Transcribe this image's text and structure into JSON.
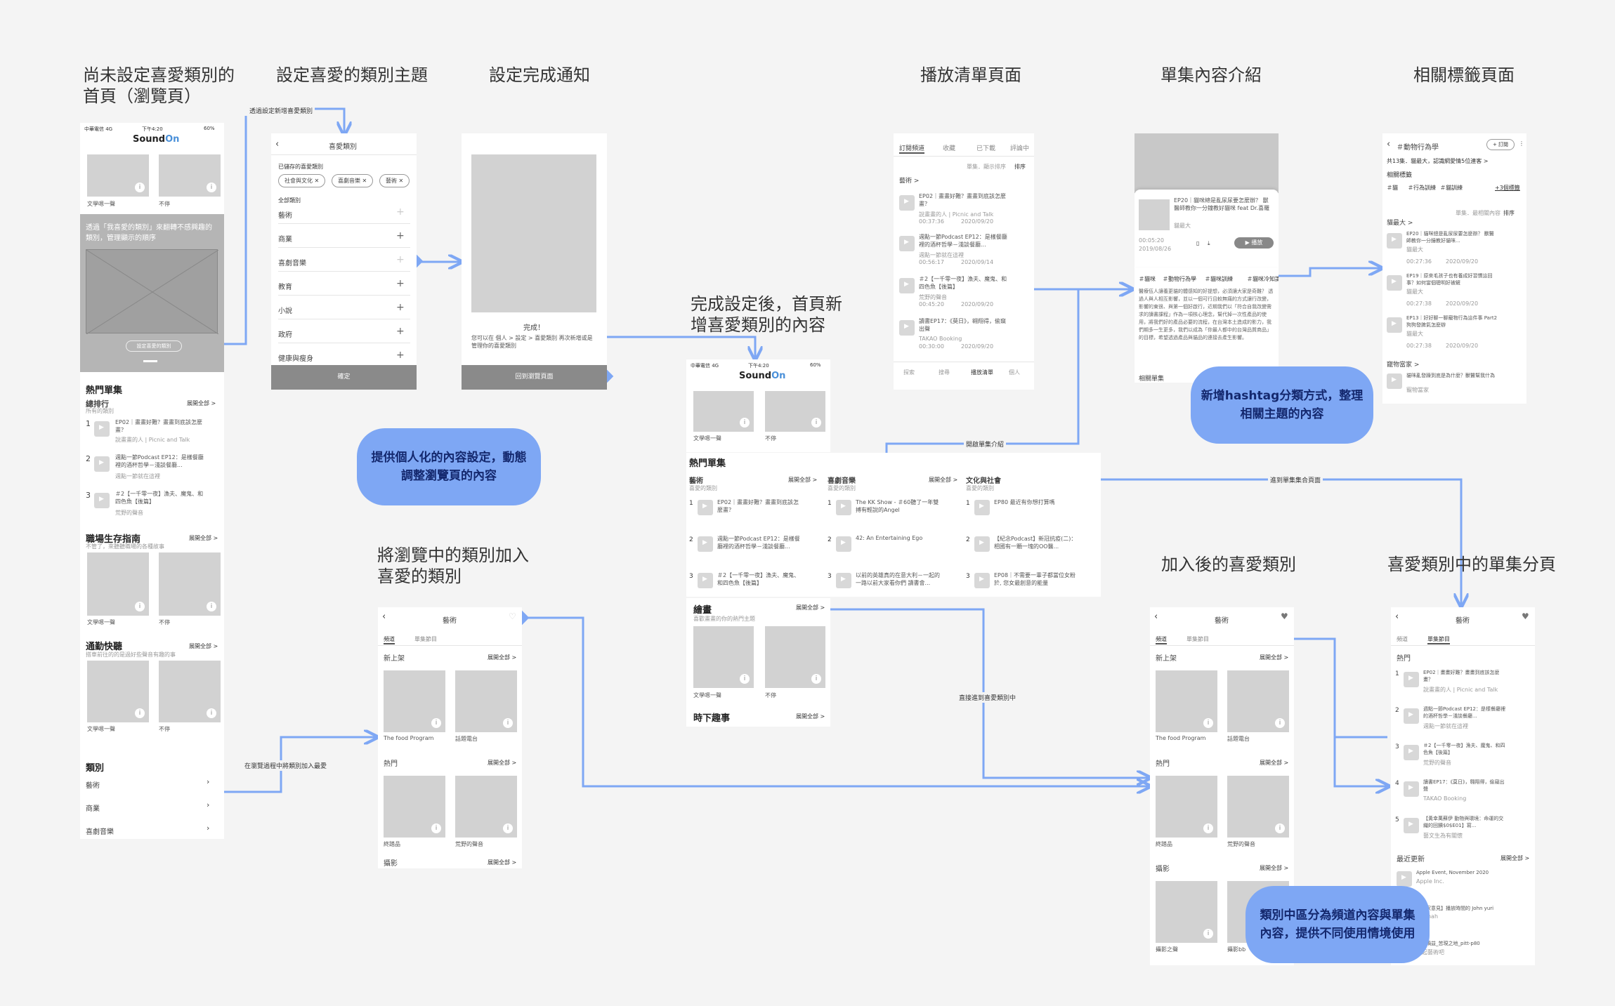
{
  "section_titles": {
    "home_unset": "尚未設定喜愛類別的\n首頁（瀏覽頁）",
    "set_fav": "設定喜愛的類別主題",
    "done_notice": "設定完成通知",
    "home_after": "完成設定後，首頁新\n增喜愛類別的內容",
    "playlist": "播放清單頁面",
    "episode_intro": "單集內容介紹",
    "tag_page": "相關標籤頁面",
    "add_browse": "將瀏覽中的類別加入\n喜愛的類別",
    "after_add": "加入後的喜愛類別",
    "fav_episode": "喜愛類別中的單集分頁"
  },
  "bubbles": {
    "personalize": "提供個人化的內容設定，動態\n調整瀏覽頁的內容",
    "hashtag": "新增hashtag分類方式，整理\n相關主題的內容",
    "channel_split": "類別中區分為頻道內容與單集\n內容，提供不同使用情境使用"
  },
  "flow_labels": {
    "via_new": "透過設定新增喜愛類別",
    "open_intro": "開啟單集介紹",
    "to_episode_page": "進到單集集合頁面",
    "add_direct": "直接進到喜愛類別中",
    "add_while_browse": "在瀏覽過程中將類別加入最愛"
  },
  "home": {
    "status_left": "中華電信 4G",
    "status_time": "下午4:20",
    "status_right": "60%",
    "logo_a": "Sound",
    "logo_b": "On",
    "thumb1": "文學嗯一聲",
    "thumb2": "不停",
    "banner_text": "透過「我喜愛的類別」來翻轉不感興趣的類別，管理顯示的順序",
    "banner_btn": "設定喜愛的類別",
    "hot_title": "熱門單集",
    "rank_title": "總排行",
    "rank_sub": "所有的類別",
    "see_all": "展開全部 >",
    "items": [
      {
        "no": "1",
        "title": "EP02｜畫畫好難？畫畫到底該怎麼畫？",
        "sub": "說畫畫的人 | Picnic and Talk"
      },
      {
        "no": "2",
        "title": "週點一節Podcast EP12：是樣餐廳裡的酒杯哲學－淺談餐廳...",
        "sub": "週點一節就在這裡"
      },
      {
        "no": "3",
        "title": "＃2【一千零一夜】漁夫、魔鬼、和四色魚【後篇】",
        "sub": "荒野的聲音"
      }
    ],
    "career_title": "職場生存指南",
    "career_sub": "不管了，來聽聽職場的各種故事",
    "commute_title": "通勤快聽",
    "commute_sub": "搭車前往的的是過好些聲音有趣的事",
    "cat_title": "類別",
    "cats": [
      "藝術",
      "商業",
      "喜劇音樂"
    ]
  },
  "setfav": {
    "header": "喜愛類別",
    "saved_label": "已儲存的喜愛類別",
    "chips": [
      "社會與文化",
      "喜劇音樂",
      "藝術"
    ],
    "all_label": "全部類別",
    "cats": [
      "藝術",
      "商業",
      "喜劇音樂",
      "教育",
      "小說",
      "政府",
      "健康與瘦身"
    ],
    "confirm": "確定"
  },
  "done": {
    "title": "完成！",
    "body": "您可以在 個人 > 設定 > 喜愛類別 再次新增或是管理你的喜愛類別",
    "btn": "回到瀏覽頁面"
  },
  "home2": {
    "hot_title": "熱門單集",
    "cols": [
      {
        "title": "藝術",
        "sub": "喜愛的類別",
        "items": [
          "EP02｜畫畫好難？畫畫到底該怎麼畫？",
          "週點一節Podcast EP12：是樣餐廳裡的酒杯哲學－淺談餐廳...",
          "＃2【一千零一夜】漁夫、魔鬼、和四色魚【後篇】"
        ]
      },
      {
        "title": "喜劇音樂",
        "sub": "喜愛的類別",
        "items": [
          "The KK Show - ＃60聽了一年雙搏有輕說的Angel",
          "42: An Entertaining Ego",
          "以前的英雄真的在意大利－一起的一路以前大家看你們 讀書會..."
        ]
      },
      {
        "title": "文化與社會",
        "sub": "喜愛的類別",
        "items": [
          "EP80 最近有你想打算嗎",
          "【紀念Podcast】新冠抗疫(二)：相國有一顆一塊的OO醫...",
          "EP08｜不需要一輩子都當位女粉 於, 您女最創意的能量"
        ]
      }
    ],
    "draw_title": "繪畫",
    "draw_sub": "喜歡畫畫的你的熱門主題",
    "thumb1": "文學嗯一聲",
    "thumb2": "不停",
    "fun_title": "時下趣事",
    "see_all": "展開全部 >"
  },
  "playlist": {
    "tabs": [
      "訂閱頻道",
      "收藏",
      "已下載",
      "評論中"
    ],
    "sort": "單集．顯示排序",
    "sort2": "排序",
    "cat": "藝術 >",
    "items": [
      {
        "title": "EP02｜畫畫好難？畫畫到底該怎麼畫？",
        "sub": "說畫畫的人 | Picnic and Talk",
        "time": "00:37:36",
        "date": "2020/09/20"
      },
      {
        "title": "週點一節Podcast EP12：是樣餐廳裡的酒杯哲學－淺談餐廳...",
        "sub": "週點一節就在這裡",
        "time": "00:56:17",
        "date": "2020/09/14"
      },
      {
        "title": "＃2【一千零一夜】漁夫、魔鬼、和四色魚【後篇】",
        "sub": "荒野的聲音",
        "time": "00:45:20",
        "date": "2020/09/20"
      },
      {
        "title": "讀書EP17：《莫日》，翱翔得，偷窺出聲",
        "sub": "TAKAO Booking",
        "time": "00:30:00",
        "date": "2020/09/20"
      }
    ],
    "nav": [
      "探索",
      "搜尋",
      "播放清單",
      "個人"
    ]
  },
  "episode": {
    "title": "EP20｜貓咪總是亂尿尿要怎麼辦？ 獸醫師教你一分鐘教好貓咪 feat Dr.喜羅",
    "author": "貓最大",
    "time": "00:05:20",
    "date": "2019/08/26",
    "play": "▶ 播放",
    "tags": [
      "＃貓咪",
      "＃動物行為學",
      "＃貓咪訓練",
      "＃貓咪冷知識"
    ],
    "desc": "醫療伍人讓養更貓的體感知的好提想，必須讓大家是奇難？ 透過人與人相互影響，並以一個可行且較無痛的方式讓行改變，影響的東很、與第一個好啟行，近期我們以「符合自我改變需求的讀書課程」作為一項核心理念，幫代掉一次性產品的使用，將我們好的產品必要的流程，在台灣本土造成的影力，我們期多一生更多，我們以成為「你最人都中的台灣品質商品」的目標，希望透過產品與貓品的連接去產生影響。",
    "related": "相關單集"
  },
  "tagpage": {
    "title": "＃動物行為學",
    "follow": "+ 訂閱",
    "count": "共13集．貓最大，認識網愛情5位連客 >",
    "related_label": "相關標籤",
    "tags": [
      "＃貓",
      "＃行為訓練",
      "＃貓訓練"
    ],
    "more": "+3個標籤",
    "sort": "單集．最相關內容",
    "sort2": "排序",
    "group1": "貓最大 >",
    "items": [
      {
        "title": "EP20｜貓咪總是亂尿尿要怎麼辦？ 獸醫師教你一分鐘教好貓咪...",
        "sub": "貓最大",
        "time": "00:27:36",
        "date": "2020/09/20"
      },
      {
        "title": "EP19｜原來毛孩子也有養成好習慣這回事？如何當個聰明好被鏟",
        "sub": "貓最大",
        "time": "00:27:38",
        "date": "2020/09/20"
      },
      {
        "title": "EP13｜好好聊一聊寵物行為這件事 Part2 狗狗發脾氣怎麼辦",
        "sub": "貓最大",
        "time": "00:27:38",
        "date": "2020/09/20"
      }
    ],
    "group2": "寵物當家 >",
    "item4": "貓咪亂發躁到底是為什麼？獸醫幫我什為",
    "item4sub": "寵物當家"
  },
  "addbrowse": {
    "header": "藝術",
    "tabs": [
      "頻道",
      "單集節目"
    ],
    "new_title": "新上架",
    "see_all": "展開全部 >",
    "t1": "The food Program",
    "t2": "話題電台",
    "hot_title": "熱門",
    "h1": "終踏品",
    "h2": "荒野的聲音",
    "photo_title": "攝影"
  },
  "afteradd": {
    "header": "藝術",
    "tabs": [
      "頻道",
      "單集節目"
    ],
    "new_title": "新上架",
    "see_all": "展開全部 >",
    "t1": "The food Program",
    "t2": "話題電台",
    "hot_title": "熱門",
    "h1": "終踏品",
    "h2": "荒野的聲音",
    "photo_title": "攝影",
    "p1": "攝影之聲",
    "p2": "攝影bb"
  },
  "favep": {
    "header": "藝術",
    "tabs": [
      "頻道",
      "單集節目"
    ],
    "hot_title": "熱門",
    "see_all": "展開全部 >",
    "items": [
      {
        "no": "1",
        "title": "EP02｜畫畫好難？畫畫到底該怎麼畫？",
        "sub": "說畫畫的人 | Picnic and Talk"
      },
      {
        "no": "2",
        "title": "週點一節Podcast EP12：是樣餐廳裡的酒杯哲學－淺談餐廳...",
        "sub": "週點一節就在這裡"
      },
      {
        "no": "3",
        "title": "＃2【一千零一夜】漁夫、魔鬼、和四色魚【後篇】",
        "sub": "荒野的聲音"
      },
      {
        "no": "4",
        "title": "讀書EP17：《莫日》，翱翔得，偷窺出聲",
        "sub": "TAKAO Booking"
      },
      {
        "no": "5",
        "title": "【黃幸萬蘇伊 動物與環境：命運的交織的回饋$0$E01】寫...",
        "sub": "藝文生為有關懷"
      }
    ],
    "recent_title": "最近更新",
    "recent": [
      {
        "title": "Apple Event, November 2020",
        "sub": "Apple Inc."
      },
      {
        "title": "【專家意見】播放時間的 John yuri",
        "sub": "Hannah"
      },
      {
        "title": "＿吳鍋益_苦現之地_pitt-p80",
        "sub": "一起藝術吧"
      }
    ]
  },
  "colors": {
    "flow": "#7ea7f4",
    "bubble": "#7ea7f4",
    "placeholder": "#d2d2d2",
    "background": "#f4f4f4"
  }
}
